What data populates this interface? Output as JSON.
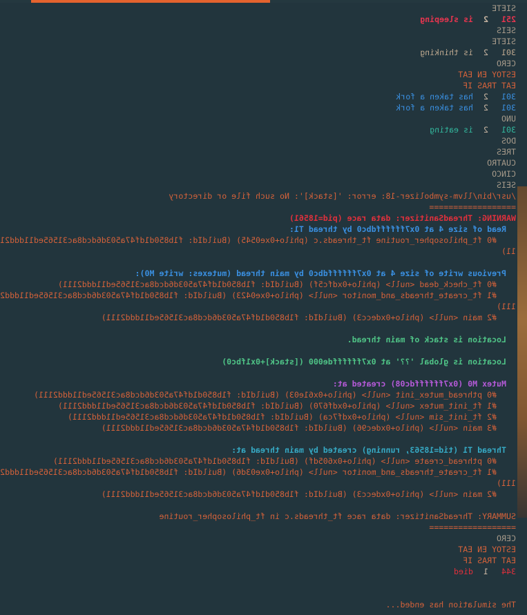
{
  "theme": {
    "background": "#22353d",
    "accent_tab": "#e4632e"
  },
  "log": [
    {
      "text": "SIETE",
      "cls": "gray"
    },
    {
      "ts": "251",
      "id": "2",
      "text": "is sleeping",
      "cls": "pink bold"
    },
    {
      "text": "SEIS",
      "cls": "gray"
    },
    {
      "text": "SIETE",
      "cls": "gray"
    },
    {
      "ts": "301",
      "id": "2",
      "text": "is thinking",
      "cls": "light"
    },
    {
      "text": "CERO",
      "cls": "gray"
    },
    {
      "text": "ESTOY EN EAT",
      "cls": "orange"
    },
    {
      "text": "EAT TRAS IF",
      "cls": "orange"
    },
    {
      "ts": "301",
      "id": "2",
      "text": "has taken a fork",
      "cls": "blue"
    },
    {
      "ts": "301",
      "id": "2",
      "text": "has taken a fork",
      "cls": "blue"
    },
    {
      "text": "UNO",
      "cls": "gray"
    },
    {
      "ts": "301",
      "id": "2",
      "text": "is eating",
      "cls": "teal"
    },
    {
      "text": "DOS",
      "cls": "gray"
    },
    {
      "text": "TRES",
      "cls": "gray"
    },
    {
      "text": "CUATRO",
      "cls": "gray"
    },
    {
      "text": "CINCO",
      "cls": "gray"
    },
    {
      "text": "SEIS",
      "cls": "gray"
    },
    {
      "text": "/usr/bin/llvm-symbolizer-18: error: '[stack]': No such file or directory",
      "cls": "orange"
    },
    {
      "text": "==================",
      "cls": "orange"
    },
    {
      "text": "WARNING: ThreadSanitizer: data race (pid=18561)",
      "cls": "red bold"
    },
    {
      "text": "  Read of size 4 at 0x7ffffffdbc0 by thread T1:",
      "cls": "blue bold"
    },
    {
      "text": "    #0 ft_philosopher_routine ft_threads.c (philo+0xe0545) (BuildId: f1b850d1df47a503d6dcd8ac31565ed11ddd2111)",
      "cls": "orange"
    },
    {
      "text": "",
      "cls": "gray"
    },
    {
      "text": "  Previous write of size 4 at 0x7ffffffdbc0 by main thread (mutexes: write M0):",
      "cls": "blue bold"
    },
    {
      "text": "    #0 ft_check_dead <null> (philo+0xdfc5f) (BuildId: f1b850d1df47a503d6dcd8ac31565ed11ddd2111)",
      "cls": "orange"
    },
    {
      "text": "    #1 ft_create_threads_and_monitor <null> (philo+0xe0423) (BuildId: f1b850d1df47a503d6dcd8ac31565ed11ddd2111)",
      "cls": "orange"
    },
    {
      "text": "    #2 main <null> (philo+0xdecc3) (BuildId: f1b850d1df47a503d6dcd8ac31565ed11ddd2111)",
      "cls": "orange"
    },
    {
      "text": "",
      "cls": "gray"
    },
    {
      "text": "  Location is stack of main thread.",
      "cls": "green bold"
    },
    {
      "text": "",
      "cls": "gray"
    },
    {
      "text": "  Location is global '??' at 0x7ffffffde000 ([stack]+0x1fbc0)",
      "cls": "green bold"
    },
    {
      "text": "",
      "cls": "gray"
    },
    {
      "text": "  Mutex M0 (0x7ffffffdc08) created at:",
      "cls": "purple bold"
    },
    {
      "text": "    #0 pthread_mutex_init <null> (philo+0x61e03) (BuildId: f1b850d1df47a503d6dcd8ac31565ed11ddd2111)",
      "cls": "orange"
    },
    {
      "text": "    #1 ft_init_mutex <null> (philo+0xdf670) (BuildId: f1b850d1df47a503d6dcd8ac31565ed11ddd2111)",
      "cls": "orange"
    },
    {
      "text": "    #2 ft_init_sim <null> (philo+0xdf7ca) (BuildId: f1b850d1df47a503d6dcd8ac31565ed11ddd2111)",
      "cls": "orange"
    },
    {
      "text": "    #3 main <null> (philo+0xdec96) (BuildId: f1b850d1df47a503d6dcd8ac31565ed11ddd2111)",
      "cls": "orange"
    },
    {
      "text": "",
      "cls": "gray"
    },
    {
      "text": "  Thread T1 (tid=18563, running) created by main thread at:",
      "cls": "cyan bold"
    },
    {
      "text": "    #0 pthread_create <null> (philo+0x605df) (BuildId: f1b850d1df47a503d6dcd8ac31565ed11ddd2111)",
      "cls": "orange"
    },
    {
      "text": "    #1 ft_create_threads_and_monitor <null> (philo+0xe03d6) (BuildId: f1b850d1df47a503d6dcd8ac31565ed11ddd2111)",
      "cls": "orange"
    },
    {
      "text": "    #2 main <null> (philo+0xdecc3) (BuildId: f1b850d1df47a503d6dcd8ac31565ed11ddd2111)",
      "cls": "orange"
    },
    {
      "text": "",
      "cls": "gray"
    },
    {
      "text": "SUMMARY: ThreadSanitizer: data race ft_threads.c in ft_philosopher_routine",
      "cls": "orange"
    },
    {
      "text": "==================",
      "cls": "orange"
    },
    {
      "text": "CERO",
      "cls": "gray"
    },
    {
      "text": "ESTOY EN EAT",
      "cls": "orange"
    },
    {
      "text": "EAT TRAS IF",
      "cls": "orange"
    },
    {
      "ts": "344",
      "id": "1",
      "text": "died",
      "cls": "red"
    },
    {
      "text": "",
      "cls": "gray"
    },
    {
      "text": "",
      "cls": "gray"
    },
    {
      "text": "The simulation has ended...",
      "cls": "orange"
    }
  ],
  "wrapped": [
    {
      "text": "11)",
      "cls": "orange"
    },
    {
      "text": "111)",
      "cls": "orange"
    },
    {
      "text": "111)",
      "cls": "orange"
    }
  ]
}
